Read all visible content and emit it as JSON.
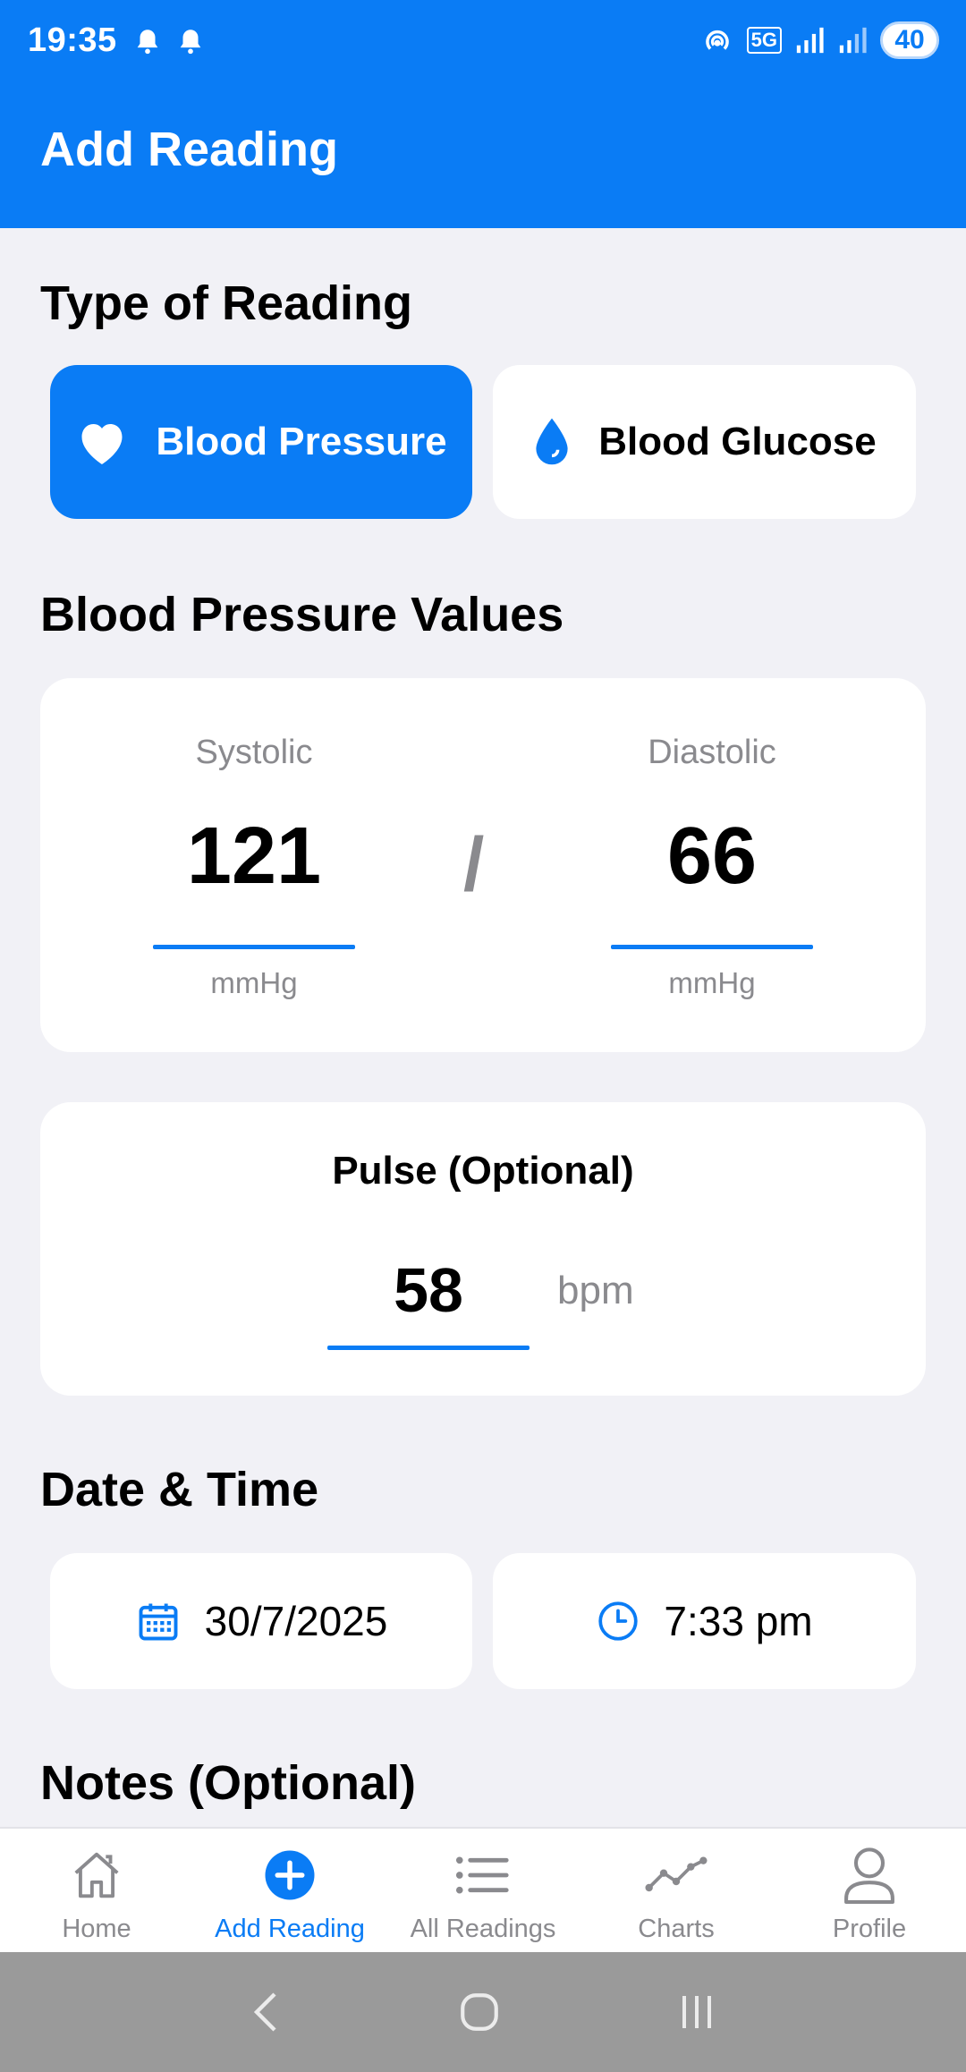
{
  "status_bar": {
    "time": "19:35",
    "network": "5G",
    "battery": "40"
  },
  "header": {
    "title": "Add Reading"
  },
  "type_section": {
    "title": "Type of Reading",
    "options": [
      {
        "label": "Blood Pressure",
        "icon": "heart-icon",
        "selected": true
      },
      {
        "label": "Blood Glucose",
        "icon": "drop-icon",
        "selected": false
      }
    ]
  },
  "bp_section": {
    "title": "Blood Pressure Values",
    "systolic": {
      "label": "Systolic",
      "value": "121",
      "unit": "mmHg"
    },
    "separator": "/",
    "diastolic": {
      "label": "Diastolic",
      "value": "66",
      "unit": "mmHg"
    }
  },
  "pulse": {
    "title": "Pulse (Optional)",
    "value": "58",
    "unit": "bpm"
  },
  "datetime_section": {
    "title": "Date & Time",
    "date": "30/7/2025",
    "time": "7:33 pm"
  },
  "notes_section": {
    "title": "Notes (Optional)"
  },
  "bottom_nav": {
    "items": [
      {
        "label": "Home",
        "icon": "home-icon"
      },
      {
        "label": "Add Reading",
        "icon": "plus-circle-icon",
        "active": true
      },
      {
        "label": "All Readings",
        "icon": "list-icon"
      },
      {
        "label": "Charts",
        "icon": "chart-line-icon"
      },
      {
        "label": "Profile",
        "icon": "person-icon"
      }
    ]
  },
  "colors": {
    "primary": "#0a7cf5",
    "background": "#f1f1f6",
    "muted": "#8a8a8e"
  }
}
